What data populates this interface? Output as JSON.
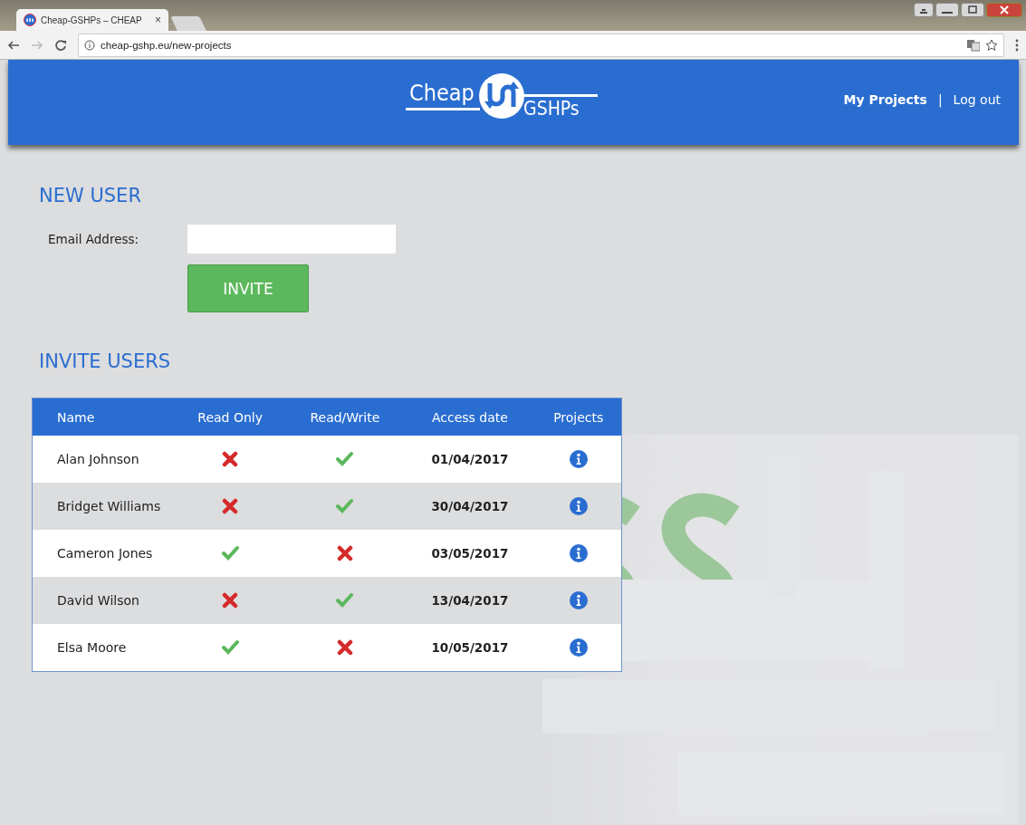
{
  "browser": {
    "tab_title": "Cheap-GSHPs – CHEAP",
    "tab_close": "×",
    "url": "cheap-gshp.eu/new-projects"
  },
  "header": {
    "logo_left": "Cheap",
    "logo_right": "GSHPs",
    "nav": [
      {
        "label": "My Projects",
        "kind": "bold"
      },
      {
        "label": "|",
        "kind": "separator"
      },
      {
        "label": "Log out",
        "kind": "plain"
      }
    ]
  },
  "new_user": {
    "title": "NEW USER",
    "email_label": "Email Address:",
    "invite_button": "INVITE"
  },
  "invite_users": {
    "title": "INVITE USERS",
    "columns": [
      "Name",
      "Read Only",
      "Read/Write",
      "Access date",
      "Projects"
    ],
    "rows": [
      {
        "name": "Alan Johnson",
        "read_only": false,
        "read_write": true,
        "access_date": "01/04/2017"
      },
      {
        "name": "Bridget Williams",
        "read_only": false,
        "read_write": true,
        "access_date": "30/04/2017"
      },
      {
        "name": "Cameron Jones",
        "read_only": true,
        "read_write": false,
        "access_date": "03/05/2017"
      },
      {
        "name": "David Wilson",
        "read_only": false,
        "read_write": true,
        "access_date": "13/04/2017"
      },
      {
        "name": "Elsa Moore",
        "read_only": true,
        "read_write": false,
        "access_date": "10/05/2017"
      }
    ]
  }
}
